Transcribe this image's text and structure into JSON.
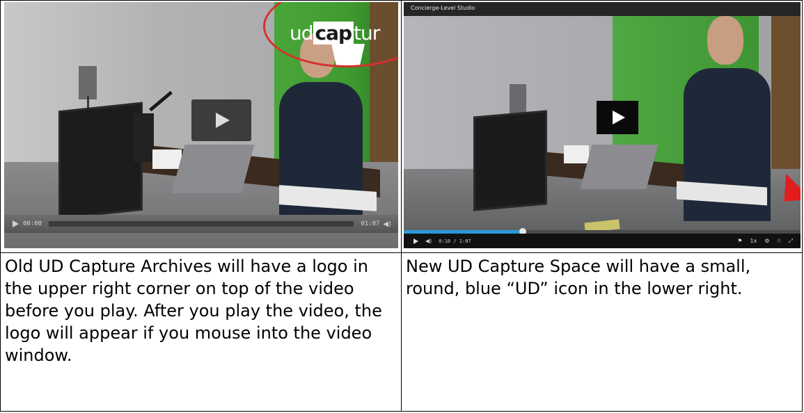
{
  "left_cell": {
    "video": {
      "logo": {
        "prefix": "ud",
        "mid": "cap",
        "suffix": "tur"
      },
      "time_current": "00:00",
      "time_total": "01:07",
      "volume_glyph": "◀)"
    },
    "caption": "Old UD Capture Archives will have a logo in the upper right corner on top of the video before you play. After you play the video, the logo will appear if you mouse into the video window."
  },
  "right_cell": {
    "video": {
      "title": "Concierge-Level Studio",
      "time_display": "0:10 / 1:07",
      "progress_fraction": 0.3,
      "control_icons": [
        "flag-icon",
        "speed-icon",
        "settings-icon",
        "grid-icon",
        "fullscreen-icon"
      ],
      "speed_label": "1x",
      "accent_color": "#2a9ad8"
    },
    "caption": "New UD Capture Space will have a small, round, blue “UD” icon in the lower right."
  }
}
